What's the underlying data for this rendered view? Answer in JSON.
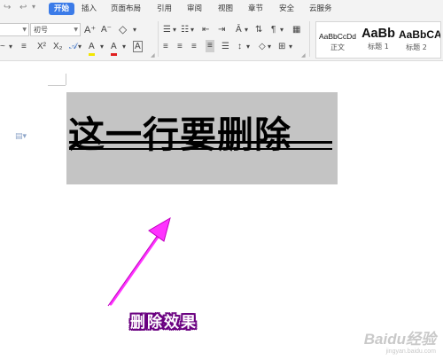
{
  "quick_access": {
    "redo_icon": "↪",
    "dropdown_icon": "▾"
  },
  "tabs": [
    {
      "label": "开始",
      "active": true
    },
    {
      "label": "插入"
    },
    {
      "label": "页面布局"
    },
    {
      "label": "引用"
    },
    {
      "label": "审阅"
    },
    {
      "label": "视图"
    },
    {
      "label": "章节"
    },
    {
      "label": "安全"
    },
    {
      "label": "云服务"
    }
  ],
  "font": {
    "size_value": "初号"
  },
  "font_buttons": {
    "grow": "A⁺",
    "shrink": "A⁻",
    "clear": "◇",
    "strike": "X²",
    "sub": "X₂",
    "font_color": "A",
    "highlight": "A",
    "char_border": "A"
  },
  "styles": [
    {
      "sample": "AaBbCcDd",
      "name": "正文"
    },
    {
      "sample": "AaBb",
      "name": "标题 1"
    },
    {
      "sample": "AaBbC",
      "name": "标题 2"
    },
    {
      "sample": "A",
      "name": ""
    }
  ],
  "document": {
    "main_text": "这一行要删除",
    "caption": "删除效果"
  },
  "watermark": {
    "brand": "Baidu经验",
    "url": "jingyan.baidu.com"
  },
  "colors": {
    "accent": "#3b7be8",
    "highlight": "#c4c4c4",
    "arrow": "#ff33ff",
    "caption_outline": "#6a0080"
  }
}
